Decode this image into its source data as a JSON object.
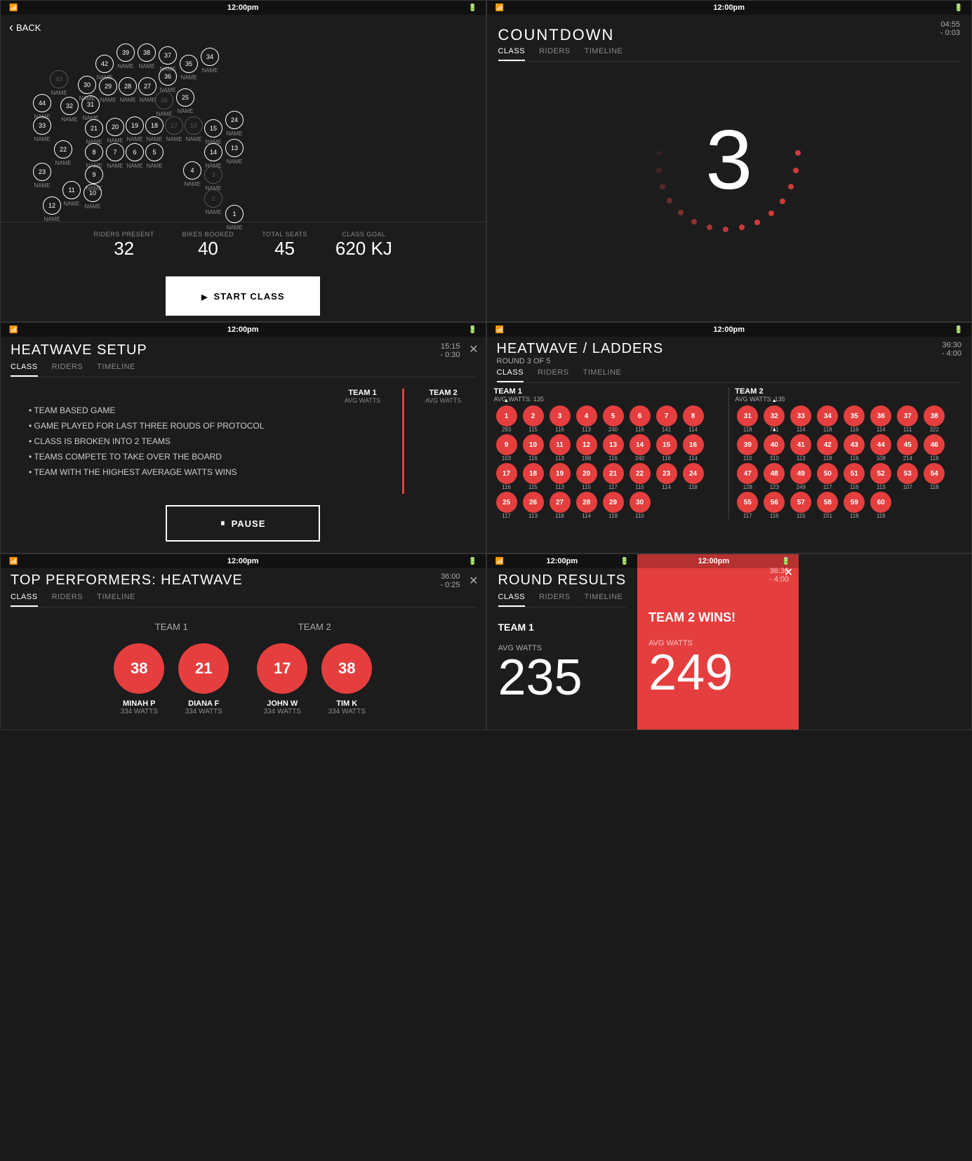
{
  "panels": {
    "panel1": {
      "status": {
        "time": "12:00pm",
        "battery": "100%"
      },
      "back_label": "BACK",
      "stats": [
        {
          "label": "RIDERS PRESENT",
          "value": "32"
        },
        {
          "label": "BIKES BOOKED",
          "value": "40"
        },
        {
          "label": "TOTAL SEATS",
          "value": "45"
        },
        {
          "label": "CLASS GOAL",
          "value": "620 KJ"
        }
      ],
      "start_button": "START CLASS",
      "riders": [
        {
          "num": "39",
          "active": true
        },
        {
          "num": "38",
          "active": true
        },
        {
          "num": "37",
          "active": true
        },
        {
          "num": "42",
          "active": true
        },
        {
          "num": "35",
          "active": true
        },
        {
          "num": "34",
          "active": true
        },
        {
          "num": "43",
          "active": false
        },
        {
          "num": "30",
          "active": true
        },
        {
          "num": "29",
          "active": true
        },
        {
          "num": "28",
          "active": true
        },
        {
          "num": "27",
          "active": true
        },
        {
          "num": "36",
          "active": true
        },
        {
          "num": "44",
          "active": true
        },
        {
          "num": "32",
          "active": true
        },
        {
          "num": "31",
          "active": true
        },
        {
          "num": "26",
          "active": false
        },
        {
          "num": "25",
          "active": true
        },
        {
          "num": "33",
          "active": true
        },
        {
          "num": "21",
          "active": true
        },
        {
          "num": "20",
          "active": true
        },
        {
          "num": "19",
          "active": true
        },
        {
          "num": "18",
          "active": true
        },
        {
          "num": "17",
          "active": false
        },
        {
          "num": "16",
          "active": false
        },
        {
          "num": "15",
          "active": true
        },
        {
          "num": "24",
          "active": true
        },
        {
          "num": "22",
          "active": true
        },
        {
          "num": "8",
          "active": true
        },
        {
          "num": "7",
          "active": true
        },
        {
          "num": "6",
          "active": true
        },
        {
          "num": "5",
          "active": true
        },
        {
          "num": "14",
          "active": true
        },
        {
          "num": "13",
          "active": true
        },
        {
          "num": "23",
          "active": true
        },
        {
          "num": "9",
          "active": true
        },
        {
          "num": "4",
          "active": true
        },
        {
          "num": "3",
          "active": false
        },
        {
          "num": "11",
          "active": true
        },
        {
          "num": "10",
          "active": true
        },
        {
          "num": "12",
          "active": true
        },
        {
          "num": "2",
          "active": false
        },
        {
          "num": "1",
          "active": true
        }
      ]
    },
    "panel2": {
      "status": {
        "time": "12:00pm"
      },
      "title": "COUNTDOWN",
      "timer": "04:55",
      "timer_sub": "- 0:03",
      "tabs": [
        "CLASS",
        "RIDERS",
        "TIMELINE"
      ],
      "active_tab": "CLASS",
      "countdown_number": "3"
    },
    "panel3": {
      "status": {
        "time": "12:00pm"
      },
      "title": "HEATWAVE SETUP",
      "timer": "15:15",
      "timer_sub": "- 0:30",
      "tabs": [
        "CLASS",
        "RIDERS",
        "TIMELINE"
      ],
      "active_tab": "CLASS",
      "rules": [
        "TEAM BASED GAME",
        "GAME PLAYED FOR LAST THREE ROUDS OF PROTOCOL",
        "CLASS IS BROKEN INTO 2 TEAMS",
        "TEAMS COMPETE TO TAKE OVER THE BOARD",
        "TEAM WITH THE HIGHEST AVERAGE WATTS WINS"
      ],
      "team1_label": "TEAM 1",
      "team1_sub": "AVG WATTS",
      "team2_label": "TEAM 2",
      "team2_sub": "AVG WATTS",
      "pause_button": "PAUSE"
    },
    "panel4": {
      "status": {
        "time": "12:00pm"
      },
      "title": "HEATWAVE / LADDERS",
      "subtitle": "ROUND 3 OF 5",
      "timer": "36:30",
      "timer_sub": "- 4:00",
      "tabs": [
        "CLASS",
        "RIDERS",
        "TIMELINE"
      ],
      "active_tab": "CLASS",
      "team1": {
        "label": "TEAM 1",
        "avg": "AVG WATTS: 135",
        "riders": [
          {
            "num": "1",
            "watts": "293",
            "leader": true
          },
          {
            "num": "2",
            "watts": "115"
          },
          {
            "num": "3",
            "watts": "116"
          },
          {
            "num": "4",
            "watts": "113"
          },
          {
            "num": "5",
            "watts": "240"
          },
          {
            "num": "6",
            "watts": "116"
          },
          {
            "num": "7",
            "watts": "141"
          },
          {
            "num": "8",
            "watts": "114"
          },
          {
            "num": "9",
            "watts": "103"
          },
          {
            "num": "10",
            "watts": "116"
          },
          {
            "num": "11",
            "watts": "113"
          },
          {
            "num": "12",
            "watts": "198"
          },
          {
            "num": "13",
            "watts": "116"
          },
          {
            "num": "14",
            "watts": "240"
          },
          {
            "num": "15",
            "watts": "116"
          },
          {
            "num": "16",
            "watts": "114"
          },
          {
            "num": "17",
            "watts": "116"
          },
          {
            "num": "18",
            "watts": "115"
          },
          {
            "num": "19",
            "watts": "113"
          },
          {
            "num": "20",
            "watts": "115"
          },
          {
            "num": "21",
            "watts": "117"
          },
          {
            "num": "22",
            "watts": "115"
          },
          {
            "num": "23",
            "watts": "114"
          },
          {
            "num": "24",
            "watts": "118"
          },
          {
            "num": "25",
            "watts": "117"
          },
          {
            "num": "26",
            "watts": "113"
          },
          {
            "num": "27",
            "watts": "118"
          },
          {
            "num": "28",
            "watts": "114"
          },
          {
            "num": "29",
            "watts": "118"
          },
          {
            "num": "30",
            "watts": "110"
          }
        ]
      },
      "team2": {
        "label": "TEAM 2",
        "avg": "AVG WATTS: 135",
        "riders": [
          {
            "num": "31",
            "watts": "118"
          },
          {
            "num": "32",
            "watts": "711",
            "leader": true
          },
          {
            "num": "33",
            "watts": "114"
          },
          {
            "num": "34",
            "watts": "118"
          },
          {
            "num": "35",
            "watts": "116"
          },
          {
            "num": "36",
            "watts": "114"
          },
          {
            "num": "37",
            "watts": "111"
          },
          {
            "num": "38",
            "watts": "322"
          },
          {
            "num": "39",
            "watts": "110"
          },
          {
            "num": "40",
            "watts": "310"
          },
          {
            "num": "41",
            "watts": "113"
          },
          {
            "num": "42",
            "watts": "118"
          },
          {
            "num": "43",
            "watts": "116"
          },
          {
            "num": "44",
            "watts": "108"
          },
          {
            "num": "45",
            "watts": "214"
          },
          {
            "num": "46",
            "watts": "118"
          },
          {
            "num": "47",
            "watts": "128"
          },
          {
            "num": "48",
            "watts": "123"
          },
          {
            "num": "49",
            "watts": "249"
          },
          {
            "num": "50",
            "watts": "117"
          },
          {
            "num": "51",
            "watts": "116"
          },
          {
            "num": "52",
            "watts": "113"
          },
          {
            "num": "53",
            "watts": "107"
          },
          {
            "num": "54",
            "watts": "118"
          },
          {
            "num": "55",
            "watts": "117"
          },
          {
            "num": "56",
            "watts": "116"
          },
          {
            "num": "57",
            "watts": "115"
          },
          {
            "num": "58",
            "watts": "151"
          },
          {
            "num": "59",
            "watts": "118"
          },
          {
            "num": "60",
            "watts": "119"
          }
        ]
      }
    },
    "panel5": {
      "status": {
        "time": "12:00pm"
      },
      "title": "TOP PERFORMERS: HEATWAVE",
      "timer": "36:00",
      "timer_sub": "- 0:25",
      "tabs": [
        "CLASS",
        "RIDERS",
        "TIMELINE"
      ],
      "active_tab": "CLASS",
      "team1_label": "TEAM 1",
      "team2_label": "TEAM 2",
      "team1_performers": [
        {
          "num": "38",
          "name": "MINAH P",
          "watts": "334 WATTS"
        },
        {
          "num": "21",
          "name": "DIANA F",
          "watts": "334 WATTS"
        }
      ],
      "team2_performers": [
        {
          "num": "17",
          "name": "JOHN W",
          "watts": "334 WATTS"
        },
        {
          "num": "38",
          "name": "TIM K",
          "watts": "334 WATTS"
        }
      ]
    },
    "panel6": {
      "status": {
        "time": "12:00pm"
      },
      "title": "ROUND RESULTS",
      "timer": "36:30",
      "timer_sub": "- 4:00",
      "tabs": [
        "CLASS",
        "RIDERS",
        "TIMELINE"
      ],
      "active_tab": "CLASS",
      "team1_label": "TEAM 1",
      "avg_label": "AVG WATTS",
      "team1_avg": "235",
      "winner_label": "TEAM 2 WINS!",
      "winner_avg_label": "AVG WATTS",
      "team2_avg": "249"
    }
  }
}
